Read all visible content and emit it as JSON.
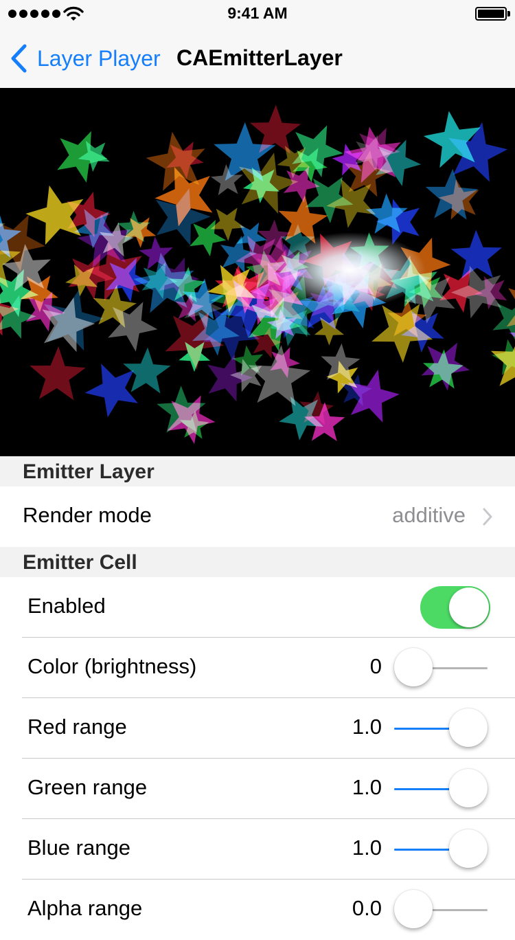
{
  "status_bar": {
    "time": "9:41 AM",
    "signal_icon": "signal-dots-icon",
    "wifi_icon": "wifi-icon",
    "battery_icon": "battery-icon"
  },
  "nav": {
    "back_label": "Layer Player",
    "title": "CAEmitterLayer",
    "accent_color": "#157efb"
  },
  "emitter_layer": {
    "header": "Emitter Layer",
    "render_mode_label": "Render mode",
    "render_mode_value": "additive"
  },
  "emitter_cell": {
    "header": "Emitter Cell",
    "enabled_label": "Enabled",
    "enabled": true,
    "toggle_color": "#4cd964",
    "sliders": [
      {
        "label": "Color (brightness)",
        "value_text": "0",
        "fraction": 0.0
      },
      {
        "label": "Red range",
        "value_text": "1.0",
        "fraction": 1.0
      },
      {
        "label": "Green range",
        "value_text": "1.0",
        "fraction": 1.0
      },
      {
        "label": "Blue range",
        "value_text": "1.0",
        "fraction": 1.0
      },
      {
        "label": "Alpha range",
        "value_text": "0.0",
        "fraction": 0.0
      }
    ]
  }
}
